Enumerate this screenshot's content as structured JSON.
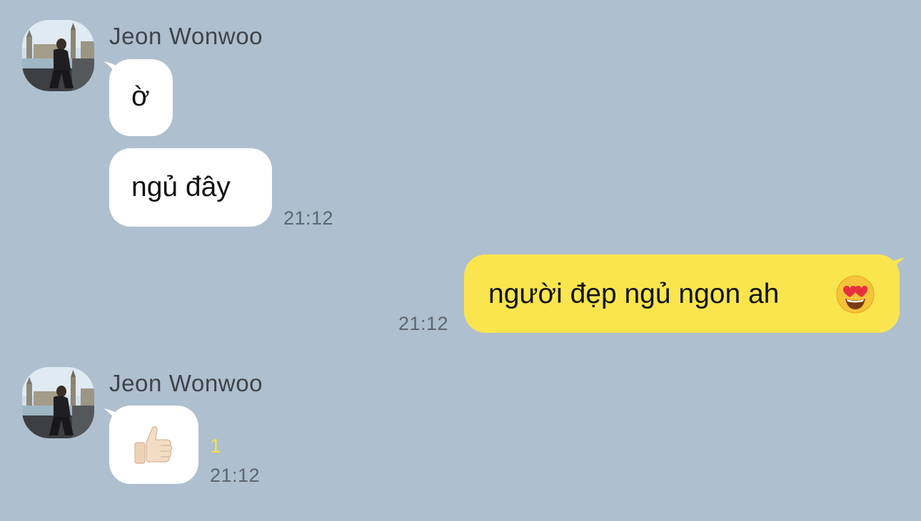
{
  "theme": {
    "background": "#aebfcf",
    "incoming_bubble": "#ffffff",
    "outgoing_bubble": "#fae54f",
    "unread_color": "#f6e04a"
  },
  "messages": [
    {
      "sender": "Jeon Wonwoo",
      "avatar_icon": "profile-photo-icon",
      "text": "ờ"
    },
    {
      "sender": "Jeon Wonwoo",
      "text": "ngủ đây",
      "time": "21:12"
    },
    {
      "sender": "me",
      "text": "người đẹp ngủ ngon ah",
      "emoji_icon": "heart-eyes-emoji-icon",
      "time": "21:12"
    },
    {
      "sender": "Jeon Wonwoo",
      "avatar_icon": "profile-photo-icon",
      "emoji_icon": "thumbs-up-emoji-icon",
      "unread_count": "1",
      "time": "21:12"
    }
  ]
}
